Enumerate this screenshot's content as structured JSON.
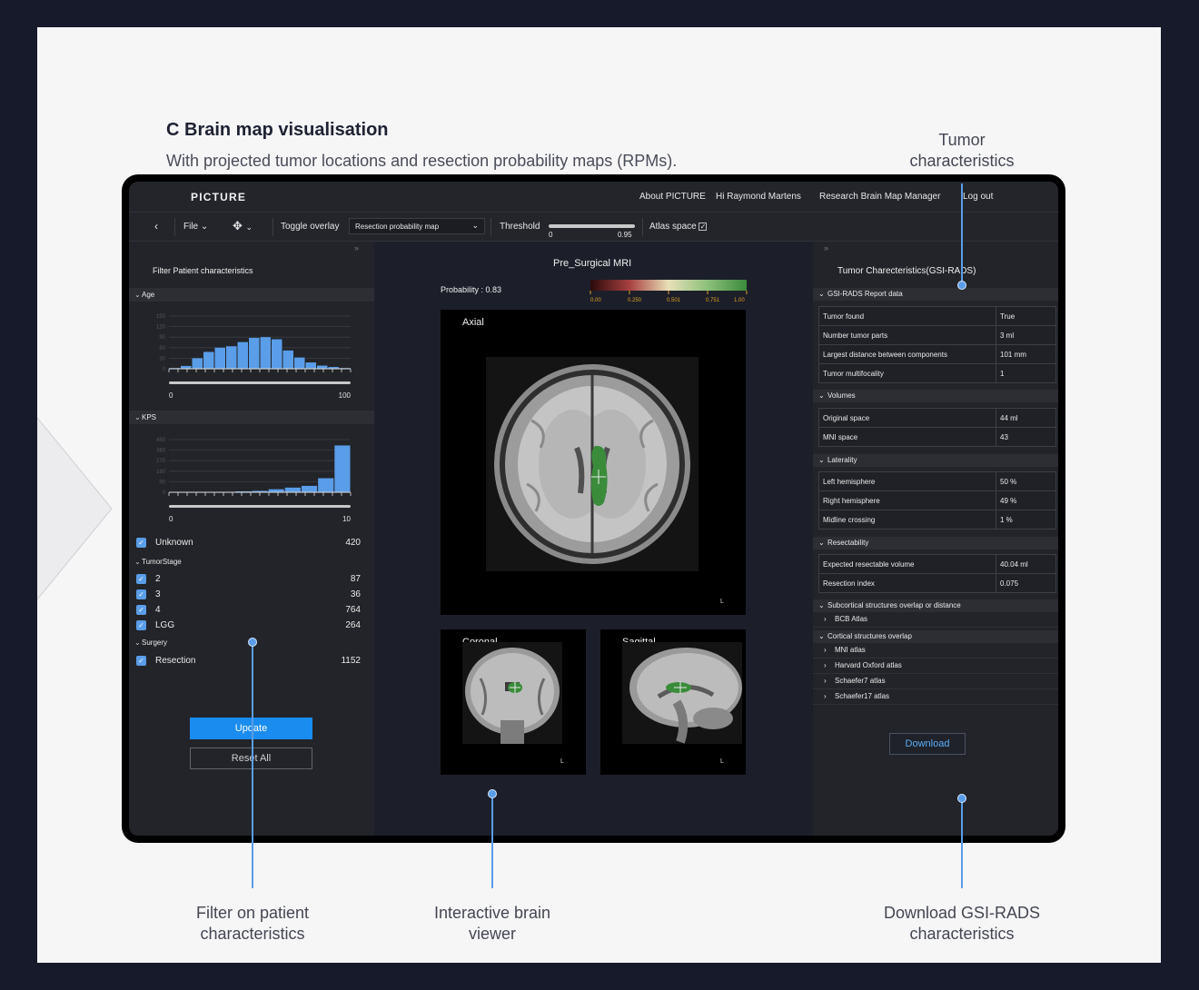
{
  "figure": {
    "heading": "C Brain map visualisation",
    "subheading": "With projected tumor locations and resection probability maps (RPMs).",
    "callouts": {
      "tumor": "Tumor\ncharacteristics",
      "filter": "Filter on patient\ncharacteristics",
      "viewer": "Interactive brain\nviewer",
      "download": "Download GSI-RADS\ncharacteristics"
    },
    "accent_color": "#5a9de8"
  },
  "app": {
    "brand": "PICTURE",
    "nav": [
      "About PICTURE",
      "Hi Raymond Martens",
      "Research Brain Map Manager",
      "Log out"
    ],
    "toolbar": {
      "back_icon": "chevron-left-icon",
      "file_label": "File",
      "move_icon": "move-arrows-icon",
      "toggle_overlay_label": "Toggle overlay",
      "overlay_value": "Resection probability map",
      "threshold_label": "Threshold",
      "threshold_min": "0",
      "threshold_max": "0.95",
      "atlas_label": "Atlas space",
      "atlas_checked": "✓"
    },
    "left": {
      "collapse": "»",
      "title": "Filter Patient characteristics",
      "age": {
        "label": "Age",
        "yticks": [
          "150",
          "120",
          "90",
          "60",
          "30",
          "0"
        ],
        "xmin": "0",
        "xmax": "100",
        "bins": [
          2,
          8,
          30,
          48,
          60,
          64,
          76,
          88,
          90,
          84,
          52,
          32,
          18,
          9,
          5,
          2
        ]
      },
      "kps": {
        "label": "KPS",
        "yticks": [
          "450",
          "360",
          "270",
          "180",
          "90",
          "0"
        ],
        "xmin": "0",
        "xmax": "10",
        "bins": [
          0,
          0,
          0,
          2,
          8,
          12,
          26,
          40,
          55,
          120,
          400
        ]
      },
      "unknown": {
        "label": "Unknown",
        "count": "420"
      },
      "tumor_stage": {
        "label": "TumorStage",
        "items": [
          {
            "label": "2",
            "count": "87"
          },
          {
            "label": "3",
            "count": "36"
          },
          {
            "label": "4",
            "count": "764"
          },
          {
            "label": "LGG",
            "count": "264"
          }
        ]
      },
      "surgery": {
        "label": "Surgery",
        "items": [
          {
            "label": "Resection",
            "count": "1152"
          }
        ]
      },
      "update": "Update",
      "reset": "Reset All"
    },
    "center": {
      "title": "Pre_Surgical MRI",
      "probability": "Probability : 0.83",
      "colorbar_ticks": [
        "0.00",
        "0.250",
        "0.501",
        "0.751",
        "1.00"
      ],
      "axial": "Axial",
      "coronal": "Coronal",
      "sagittal": "Sagittal",
      "side_marker": "L"
    },
    "right": {
      "collapse": "»",
      "title": "Tumor Charecteristics(GSI-RADS)",
      "report": {
        "label": "GSI-RADS Report data",
        "rows": [
          {
            "k": "Tumor found",
            "v": "True"
          },
          {
            "k": "Number tumor parts",
            "v": "3 ml"
          },
          {
            "k": "Largest distance between components",
            "v": "101 mm"
          },
          {
            "k": "Tumor multifocality",
            "v": "1"
          }
        ]
      },
      "volumes": {
        "label": "Volumes",
        "rows": [
          {
            "k": "Original space",
            "v": "44 ml"
          },
          {
            "k": "MNI space",
            "v": "43"
          }
        ]
      },
      "laterality": {
        "label": "Laterality",
        "rows": [
          {
            "k": "Left hemisphere",
            "v": "50 %"
          },
          {
            "k": "Right hemisphere",
            "v": "49 %"
          },
          {
            "k": "Midline crossing",
            "v": "1 %"
          }
        ]
      },
      "resectability": {
        "label": "Resectability",
        "rows": [
          {
            "k": "Expected resectable volume",
            "v": "40.04 ml"
          },
          {
            "k": "Resection index",
            "v": "0.075"
          }
        ]
      },
      "subcortical": {
        "label": "Subcortical structures overlap or distance",
        "items": [
          "BCB Atlas"
        ]
      },
      "cortical": {
        "label": "Cortical structures overlap",
        "items": [
          "MNI atlas",
          "Harvard Oxford atlas",
          "Schaefer7 atlas",
          "Schaefer17 atlas"
        ]
      },
      "download": "Download"
    }
  }
}
